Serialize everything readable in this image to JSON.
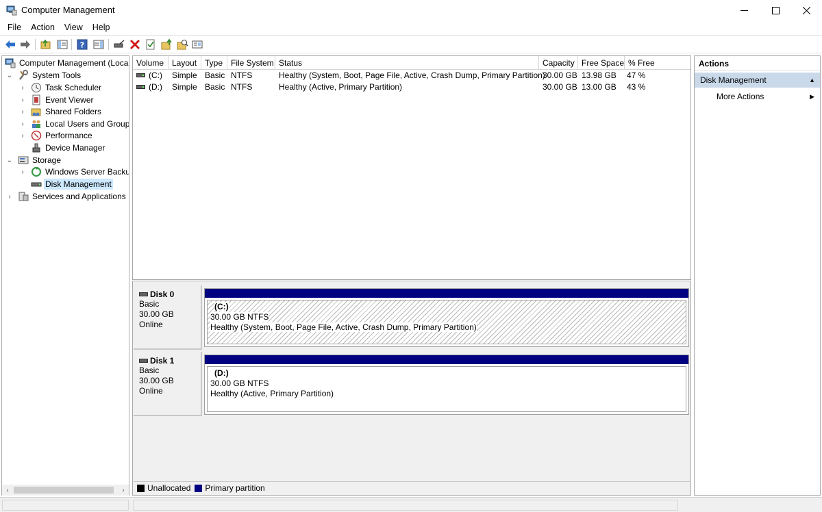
{
  "window": {
    "title": "Computer Management"
  },
  "menu": [
    "File",
    "Action",
    "View",
    "Help"
  ],
  "toolbar_icons": [
    "back-icon",
    "forward-icon",
    "up-folder-icon",
    "show-hide-tree-icon",
    "help-icon",
    "show-hide-action-pane-icon",
    "connect-disk-icon",
    "delete-icon",
    "properties-icon",
    "folder-up-icon",
    "search-folder-icon",
    "console-icon"
  ],
  "tree": {
    "root": "Computer Management (Local",
    "system_tools": "System Tools",
    "task_scheduler": "Task Scheduler",
    "event_viewer": "Event Viewer",
    "shared_folders": "Shared Folders",
    "local_users": "Local Users and Groups",
    "performance": "Performance",
    "device_manager": "Device Manager",
    "storage": "Storage",
    "wsb": "Windows Server Backup",
    "disk_management": "Disk Management",
    "services": "Services and Applications"
  },
  "columns": [
    "Volume",
    "Layout",
    "Type",
    "File System",
    "Status",
    "Capacity",
    "Free Space",
    "% Free"
  ],
  "volumes": [
    [
      "(C:)",
      "Simple",
      "Basic",
      "NTFS",
      "Healthy (System, Boot, Page File, Active, Crash Dump, Primary Partition)",
      "30.00 GB",
      "13.98 GB",
      "47 %"
    ],
    [
      "(D:)",
      "Simple",
      "Basic",
      "NTFS",
      "Healthy (Active, Primary Partition)",
      "30.00 GB",
      "13.00 GB",
      "43 %"
    ]
  ],
  "disks": [
    {
      "name": "Disk 0",
      "type": "Basic",
      "size": "30.00 GB",
      "state": "Online",
      "partition": {
        "name": "(C:)",
        "size": "30.00 GB NTFS",
        "status": "Healthy (System, Boot, Page File, Active, Crash Dump, Primary Partition)"
      }
    },
    {
      "name": "Disk 1",
      "type": "Basic",
      "size": "30.00 GB",
      "state": "Online",
      "partition": {
        "name": "(D:)",
        "size": "30.00 GB NTFS",
        "status": "Healthy (Active, Primary Partition)"
      }
    }
  ],
  "legend": {
    "unallocated": "Unallocated",
    "primary": "Primary partition",
    "unallocated_color": "#000000",
    "primary_color": "#000080"
  },
  "actions": {
    "header": "Actions",
    "section": "Disk Management",
    "more": "More Actions"
  }
}
